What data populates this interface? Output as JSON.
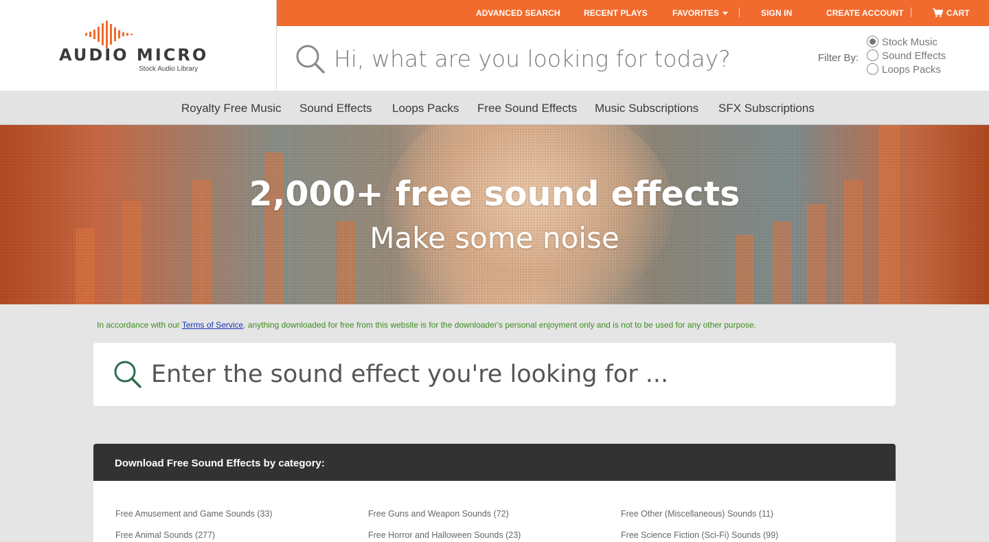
{
  "colors": {
    "brand_orange": "#f26b2e",
    "dark_header": "#323232",
    "notice_green": "#3c8c1e",
    "link_blue": "#1a33b8"
  },
  "logo": {
    "name": "AUDIO MICRO",
    "tagline": "Stock Audio Library"
  },
  "topbar": {
    "advanced_search": "ADVANCED SEARCH",
    "recent_plays": "RECENT PLAYS",
    "favorites": "FAVORITES",
    "sign_in": "SIGN IN",
    "create_account": "CREATE ACCOUNT",
    "cart": "CART",
    "cart_icon": "cart-icon"
  },
  "search": {
    "placeholder": "Hi, what are you looking for today?",
    "filter_label": "Filter By:",
    "filter_options": [
      {
        "label": "Stock Music",
        "checked": true
      },
      {
        "label": "Sound Effects",
        "checked": false
      },
      {
        "label": "Loops Packs",
        "checked": false
      }
    ]
  },
  "nav": {
    "items": [
      "Royalty Free Music",
      "Sound Effects",
      "Loops Packs",
      "Free Sound Effects",
      "Music Subscriptions",
      "SFX Subscriptions"
    ]
  },
  "hero": {
    "title": "2,000+ free sound effects",
    "subtitle": "Make some noise"
  },
  "notice": {
    "before": "In accordance with our ",
    "link": "Terms of Service",
    "after": ", anything downloaded for free from this website is for the downloader's personal enjoyment only and is not to be used for any other purpose."
  },
  "sfx_search": {
    "placeholder": "Enter the sound effect you're looking for ..."
  },
  "categories": {
    "title": "Download Free Sound Effects by category:",
    "items": [
      "Free Amusement and Game Sounds  (33)",
      "Free Guns and Weapon Sounds  (72)",
      "Free Other (Miscellaneous) Sounds  (11)",
      "Free Animal Sounds  (277)",
      "Free Horror and Halloween Sounds  (23)",
      "Free Science Fiction (Sci-Fi) Sounds  (99)"
    ]
  }
}
